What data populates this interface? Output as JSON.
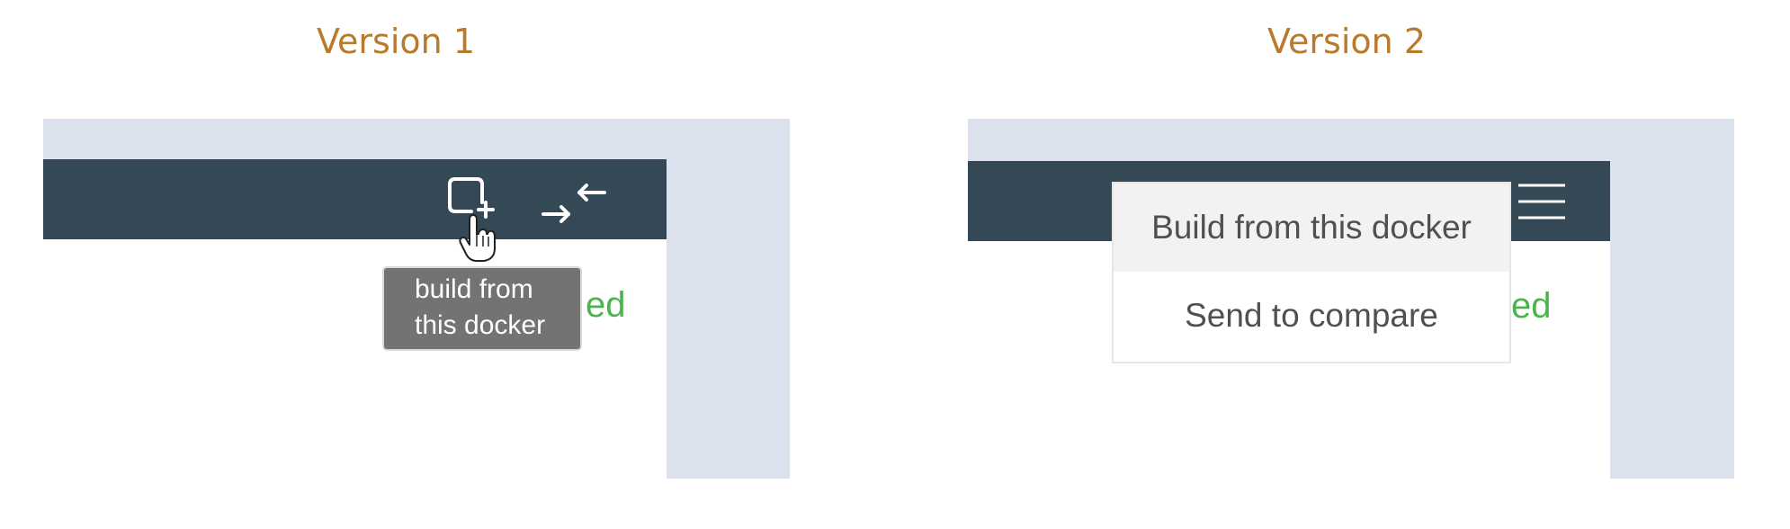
{
  "versions": [
    {
      "title": "Version 1",
      "icons": [
        "add-square-icon",
        "compare-arrows-icon",
        "hand-pointer-icon"
      ],
      "tooltip": {
        "line1": "build from",
        "line2": "this docker"
      },
      "status_fragment": "ed"
    },
    {
      "title": "Version 2",
      "icons": [
        "hamburger-menu-icon"
      ],
      "menu_items": [
        "Build from this docker",
        "Send to compare"
      ],
      "status_fragment": "ed"
    }
  ],
  "colors": {
    "title": "#b87a2d",
    "header": "#344955",
    "background": "#dbe2ee",
    "status_green": "#4db34d",
    "tooltip_bg": "#737373",
    "menu_active_bg": "#f2f2f2"
  }
}
